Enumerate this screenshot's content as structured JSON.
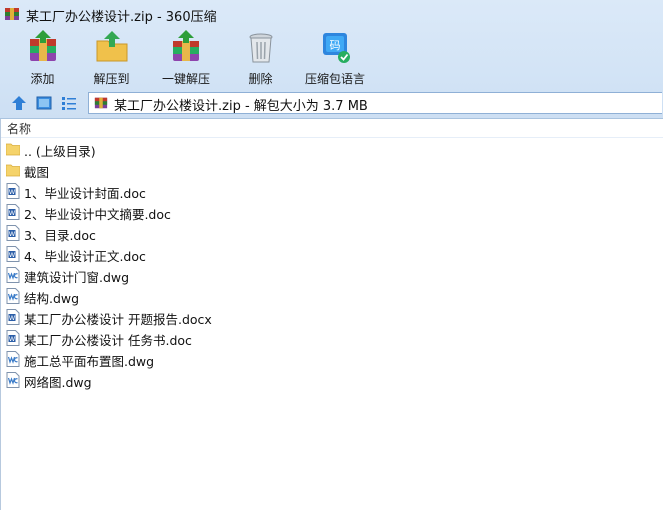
{
  "window": {
    "title": "某工厂办公楼设计.zip - 360压缩",
    "app_icon": "archive-icon"
  },
  "toolbar": [
    {
      "label": "添加",
      "icon": "add-archive-icon"
    },
    {
      "label": "解压到",
      "icon": "extract-to-icon"
    },
    {
      "label": "一键解压",
      "icon": "one-click-extract-icon"
    },
    {
      "label": "删除",
      "icon": "trash-icon"
    },
    {
      "label": "压缩包语言",
      "icon": "language-icon"
    }
  ],
  "navbar": {
    "path_text": "某工厂办公楼设计.zip - 解包大小为 3.7 MB"
  },
  "list": {
    "column_name": "名称",
    "rows": [
      {
        "name": ".. (上级目录)",
        "type": "folder"
      },
      {
        "name": "截图",
        "type": "folder"
      },
      {
        "name": "1、毕业设计封面.doc",
        "type": "doc"
      },
      {
        "name": "2、毕业设计中文摘要.doc",
        "type": "doc"
      },
      {
        "name": "3、目录.doc",
        "type": "doc"
      },
      {
        "name": "4、毕业设计正文.doc",
        "type": "doc"
      },
      {
        "name": "建筑设计门窗.dwg",
        "type": "dwg"
      },
      {
        "name": "结构.dwg",
        "type": "dwg"
      },
      {
        "name": "某工厂办公楼设计 开题报告.docx",
        "type": "doc"
      },
      {
        "name": "某工厂办公楼设计 任务书.doc",
        "type": "doc"
      },
      {
        "name": "施工总平面布置图.dwg",
        "type": "dwg"
      },
      {
        "name": "网络图.dwg",
        "type": "dwg"
      }
    ]
  },
  "colors": {
    "toolbar_bg": "#d3e4f6",
    "folder": "#f5d36b",
    "doc_blue": "#2b5ea8",
    "dwg_blue": "#3a7bc8"
  }
}
